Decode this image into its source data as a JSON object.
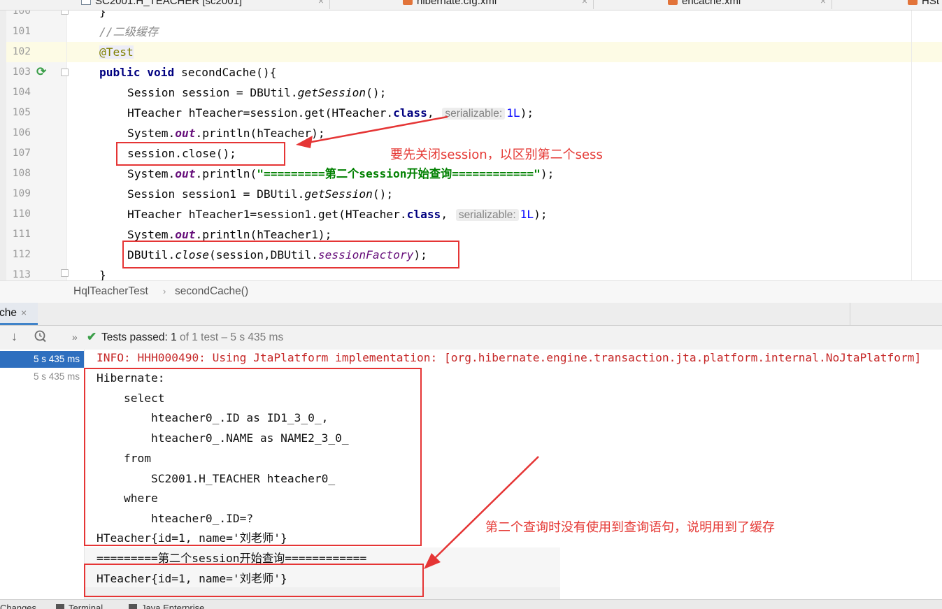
{
  "tabs": [
    {
      "name": "SC2001.H_TEACHER [sc2001]",
      "icon": "table-icon"
    },
    {
      "name": "hibernate.cfg.xml",
      "icon": "xml-file-icon"
    },
    {
      "name": "ehcache.xml",
      "icon": "xml-file-icon"
    },
    {
      "name": "HSt",
      "icon": "xml-file-icon"
    }
  ],
  "tab_close": "×",
  "editor": {
    "lines": [
      {
        "num": "100",
        "text": "}"
      },
      {
        "num": "101",
        "text": "//二级缓存"
      },
      {
        "num": "102",
        "text": "@Test"
      },
      {
        "num": "103",
        "text": "public void secondCache(){"
      },
      {
        "num": "104",
        "text": "Session session = DBUtil.getSession();"
      },
      {
        "num": "105",
        "text": "HTeacher hTeacher=session.get(HTeacher.class, serializable: 1L);"
      },
      {
        "num": "106",
        "text": "System.out.println(hTeacher);"
      },
      {
        "num": "107",
        "text": "session.close();"
      },
      {
        "num": "108",
        "text": "System.out.println(\"=========第二个session开始查询============\");"
      },
      {
        "num": "109",
        "text": "Session session1 = DBUtil.getSession();"
      },
      {
        "num": "110",
        "text": "HTeacher hTeacher1=session1.get(HTeacher.class, serializable: 1L);"
      },
      {
        "num": "111",
        "text": "System.out.println(hTeacher1);"
      },
      {
        "num": "112",
        "text": "DBUtil.close(session,DBUtil.sessionFactory);"
      },
      {
        "num": "113",
        "text": "}"
      }
    ],
    "tokens": {
      "comment": "//二级缓存",
      "annotation": "@Test",
      "kw_public": "public",
      "kw_void": "void",
      "kw_class": "class",
      "method_name": "secondCache(){",
      "session_type": "Session session = DBUtil.",
      "get_session": "getSession",
      "call_end": "();",
      "hteacher_decl": "HTeacher hTeacher=session.get(HTeacher.",
      "hteacher1_decl": "HTeacher hTeacher1=session1.get(HTeacher.",
      "comma": ",",
      "hint_label": "serializable:",
      "one_l": "1L",
      "close_paren": ");",
      "system": "System.",
      "out": "out",
      "println_ht": ".println(hTeacher);",
      "println_ht1": ".println(hTeacher1);",
      "println_open": ".println(",
      "string_literal": "\"=========第二个session开始查询============\"",
      "session_close": "session.close();",
      "session1_decl": "Session session1 = DBUtil.",
      "dbutil": "DBUtil.",
      "close_m": "close",
      "close_args": "(session,DBUtil.",
      "session_factory": "sessionFactory",
      "brace_close": "}"
    }
  },
  "breadcrumb": {
    "class_name": "HqlTeacherTest",
    "separator": "›",
    "method": "secondCache()"
  },
  "run_window": {
    "tab_label": "che",
    "tab_close": "×",
    "toolbar_more": "»",
    "status_strong": "Tests passed: 1",
    "status_muted": " of 1 test – 5 s 435 ms",
    "tree": [
      {
        "time": "5 s 435 ms",
        "selected": true
      },
      {
        "time": "5 s 435 ms",
        "selected": false
      }
    ],
    "console": [
      {
        "text": "INFO: HHH000490: Using JtaPlatform implementation: [org.hibernate.engine.transaction.jta.platform.internal.NoJtaPlatform]",
        "kind": "err"
      },
      {
        "text": "Hibernate:",
        "kind": "out"
      },
      {
        "text": "    select",
        "kind": "out"
      },
      {
        "text": "        hteacher0_.ID as ID1_3_0_,",
        "kind": "out"
      },
      {
        "text": "        hteacher0_.NAME as NAME2_3_0_",
        "kind": "out"
      },
      {
        "text": "    from",
        "kind": "out"
      },
      {
        "text": "        SC2001.H_TEACHER hteacher0_",
        "kind": "out"
      },
      {
        "text": "    where",
        "kind": "out"
      },
      {
        "text": "        hteacher0_.ID=?",
        "kind": "out"
      },
      {
        "text": "HTeacher{id=1, name='刘老师'}",
        "kind": "out"
      },
      {
        "text": "=========第二个session开始查询============",
        "kind": "out"
      },
      {
        "text": "HTeacher{id=1, name='刘老师'}",
        "kind": "out"
      }
    ]
  },
  "bottom_bar": [
    "Changes",
    "Terminal",
    "Java Enterprise"
  ],
  "annotations": {
    "note1": "要先关闭session，以区别第二个sess",
    "note2": "第二个查询时没有使用到查询语句，说明用到了缓存"
  },
  "colors": {
    "annotation_red": "#e53535",
    "keyword": "#000080",
    "string": "#008000",
    "selected": "#2e6fbf",
    "passed_green": "#3a9e48"
  }
}
